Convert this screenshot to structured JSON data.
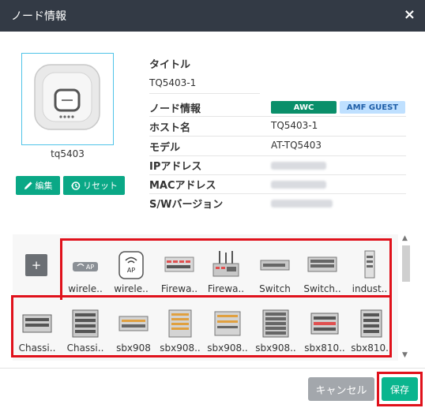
{
  "dialog": {
    "title": "ノード情報",
    "close_icon": "×"
  },
  "node": {
    "name": "tq5403",
    "edit_label": "編集",
    "reset_label": "リセット"
  },
  "info": {
    "title_label": "タイトル",
    "title_value": "TQ5403-1",
    "section_label": "ノード情報",
    "badges": [
      "AWC",
      "AMF GUEST"
    ],
    "host_label": "ホスト名",
    "host_value": "TQ5403-1",
    "model_label": "モデル",
    "model_value": "AT-TQ5403",
    "ip_label": "IPアドレス",
    "mac_label": "MACアドレス",
    "sw_label": "S/Wバージョン"
  },
  "palette": {
    "add_label": "+",
    "row1": [
      "wirele..",
      "wirele..",
      "Firewa..",
      "Firewa..",
      "Switch",
      "Switch..",
      "indust.."
    ],
    "row2": [
      "Chassi..",
      "Chassi..",
      "sbx908",
      "sbx908..",
      "sbx908..",
      "sbx908..",
      "sbx810..",
      "sbx810.."
    ]
  },
  "footer": {
    "cancel_label": "キャンセル",
    "save_label": "保存"
  },
  "colors": {
    "header_bg": "#333a45",
    "accent_green": "#0aa886",
    "highlight_red": "#e0111b",
    "awc_badge": "#0a8f6a",
    "amf_badge": "#bfe0ff"
  }
}
